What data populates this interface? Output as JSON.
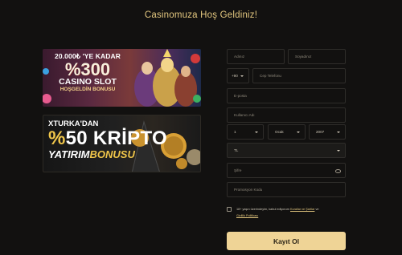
{
  "header": {
    "title": "Casinomuza Hoş Geldiniz!"
  },
  "banners": {
    "slot": {
      "line1": "20.000₺ 'YE KADAR",
      "line2": "%300",
      "line3": "CASINO SLOT",
      "line4": "HOŞGELDİN BONUSU"
    },
    "crypto": {
      "line1": "XTURKA'DAN",
      "pct": "%",
      "line2": "50 KRİPTO",
      "line3a": "YATIRIM",
      "line3b": "BONUSU"
    }
  },
  "form": {
    "first_name": "Adınız",
    "last_name": "Soyadınız",
    "phone_code": "+90",
    "phone": "Cep Telefonu",
    "email": "E-posta",
    "username": "Kullanıcı Adı",
    "birth_day": "1",
    "birth_month": "Ocak",
    "birth_year": "2007",
    "currency": "TL",
    "password": "Şifre",
    "promo_code": "Promosyon Kodu",
    "consent_text": "18+ yaşın üzerindeyim, kabul ediyorum",
    "terms_link": "Kurallar ve Şartlar",
    "and": "ve",
    "privacy_link": "Gizlilik Politikası",
    "submit_label": "Kayıt Ol"
  },
  "colors": {
    "accent": "#e3c77f",
    "button": "#efd496",
    "background": "#121110"
  }
}
